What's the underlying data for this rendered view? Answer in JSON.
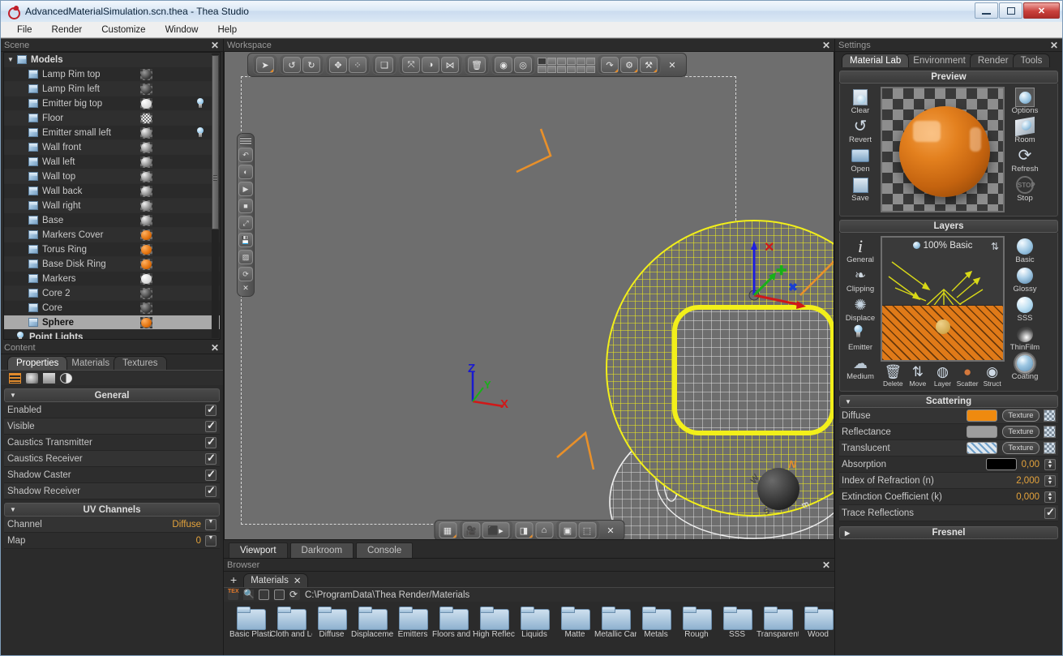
{
  "window": {
    "title": "AdvancedMaterialSimulation.scn.thea - Thea Studio",
    "app_icon": "thea-logo-icon",
    "minimize": "—",
    "maximize": "❐",
    "close": "✕"
  },
  "menu": [
    "File",
    "Render",
    "Customize",
    "Window",
    "Help"
  ],
  "scene_panel": {
    "title": "Scene",
    "close": "✕",
    "items": [
      {
        "label": "Models",
        "type": "group",
        "arrow": "▼",
        "thumb": null,
        "lamp": false
      },
      {
        "label": "Lamp Rim top",
        "type": "model",
        "thumb": "dark",
        "lamp": false
      },
      {
        "label": "Lamp Rim left",
        "type": "model",
        "thumb": "dark",
        "lamp": false
      },
      {
        "label": "Emitter big top",
        "type": "model",
        "thumb": "white",
        "lamp": true
      },
      {
        "label": "Floor",
        "type": "model",
        "thumb": "check",
        "lamp": false
      },
      {
        "label": "Emitter small left",
        "type": "model",
        "thumb": "grey",
        "lamp": true
      },
      {
        "label": "Wall front",
        "type": "model",
        "thumb": "grey",
        "lamp": false
      },
      {
        "label": "Wall left",
        "type": "model",
        "thumb": "grey",
        "lamp": false
      },
      {
        "label": "Wall top",
        "type": "model",
        "thumb": "grey",
        "lamp": false
      },
      {
        "label": "Wall back",
        "type": "model",
        "thumb": "grey",
        "lamp": false
      },
      {
        "label": "Wall right",
        "type": "model",
        "thumb": "grey",
        "lamp": false
      },
      {
        "label": "Base",
        "type": "model",
        "thumb": "grey",
        "lamp": false
      },
      {
        "label": "Markers Cover",
        "type": "model",
        "thumb": "orange",
        "lamp": false
      },
      {
        "label": "Torus Ring",
        "type": "model",
        "thumb": "orange",
        "lamp": false
      },
      {
        "label": "Base Disk Ring",
        "type": "model",
        "thumb": "orange",
        "lamp": false
      },
      {
        "label": "Markers",
        "type": "model",
        "thumb": "white",
        "lamp": false
      },
      {
        "label": "Core 2",
        "type": "model",
        "thumb": "dark",
        "lamp": false
      },
      {
        "label": "Core",
        "type": "model",
        "thumb": "dark",
        "lamp": false
      },
      {
        "label": "Sphere",
        "type": "model",
        "thumb": "orange",
        "lamp": false,
        "selected": true
      },
      {
        "label": "Point Lights",
        "type": "lights",
        "thumb": null,
        "lamp": false
      }
    ]
  },
  "content_panel": {
    "title": "Content",
    "close": "✕",
    "tabs": [
      {
        "label": "Properties",
        "active": true
      },
      {
        "label": "Materials",
        "active": false
      },
      {
        "label": "Textures",
        "active": false
      }
    ],
    "toolbar_icons": [
      "list-icon",
      "camera-icon",
      "clapperboard-icon",
      "sun-icon"
    ],
    "sections": [
      {
        "title": "General",
        "arrow": "▼",
        "rows": [
          {
            "label": "Enabled",
            "kind": "check",
            "checked": true
          },
          {
            "label": "Visible",
            "kind": "check",
            "checked": true
          },
          {
            "label": "Caustics Transmitter",
            "kind": "check",
            "checked": true
          },
          {
            "label": "Caustics Receiver",
            "kind": "check",
            "checked": true
          },
          {
            "label": "Shadow Caster",
            "kind": "check",
            "checked": true
          },
          {
            "label": "Shadow Receiver",
            "kind": "check",
            "checked": true
          }
        ]
      },
      {
        "title": "UV Channels",
        "arrow": "▼",
        "rows": [
          {
            "label": "Channel",
            "kind": "dropdown",
            "value": "Diffuse"
          },
          {
            "label": "Map",
            "kind": "dropdown",
            "value": "0"
          }
        ]
      }
    ]
  },
  "workspace": {
    "title": "Workspace",
    "close": "✕",
    "toolbar": {
      "groups": [
        {
          "buttons": [
            {
              "icon": "select-arrow-icon",
              "active": true
            }
          ]
        },
        {
          "buttons": [
            {
              "icon": "undo-icon"
            },
            {
              "icon": "redo-icon"
            }
          ]
        },
        {
          "buttons": [
            {
              "icon": "move-gizmo-icon"
            },
            {
              "icon": "points-icon"
            }
          ]
        },
        {
          "buttons": [
            {
              "icon": "copy-objects-icon"
            }
          ]
        },
        {
          "buttons": [
            {
              "icon": "axis-translate-icon"
            },
            {
              "icon": "rotate-icon"
            },
            {
              "icon": "node-icon"
            }
          ]
        },
        {
          "buttons": [
            {
              "icon": "trash-icon"
            }
          ]
        },
        {
          "buttons": [
            {
              "icon": "eye-icon"
            },
            {
              "icon": "eye-off-icon"
            }
          ]
        },
        {
          "buttons": [
            {
              "icon": "layer-grid-icon"
            }
          ]
        },
        {
          "buttons": [
            {
              "icon": "curve-arrow-icon"
            },
            {
              "icon": "gear-icon"
            },
            {
              "icon": "tools-icon"
            }
          ]
        },
        {
          "buttons": [
            {
              "icon": "close-icon"
            }
          ]
        }
      ]
    },
    "left_toolbar": [
      "grip-handle",
      "render-arc-icon",
      "render-play-circle-icon",
      "play-icon",
      "stop-icon",
      "fit-view-icon",
      "save-render-icon",
      "checker-icon",
      "refresh-icon",
      "close-icon"
    ],
    "bottom_toolbar": [
      "grid-display-icon",
      "camera-filmstrip-icon",
      "camera-lock-icon",
      "gradient-icon",
      "perspective-icon",
      "box-select-icon",
      "marquee-select-icon",
      "close-icon"
    ],
    "axis_gizmo": {
      "z": "Z",
      "y": "Y",
      "x": "X"
    },
    "compass": {
      "n": "N",
      "w": "W",
      "s": "S",
      "e": "E"
    },
    "tabs": [
      {
        "label": "Viewport",
        "active": true
      },
      {
        "label": "Darkroom",
        "active": false
      },
      {
        "label": "Console",
        "active": false
      }
    ]
  },
  "browser": {
    "title": "Browser",
    "close": "✕",
    "add_label": "+",
    "tab": {
      "label": "Materials",
      "close": "✕"
    },
    "path_icons": [
      "tex-icon",
      "search-icon",
      "up-folder-icon",
      "home-folder-icon",
      "refresh-icon"
    ],
    "path": "C:\\ProgramData\\Thea Render/Materials",
    "folders": [
      "Basic Plastic",
      "Cloth and Le",
      "Diffuse",
      "Displaceme",
      "Emitters",
      "Floors and T",
      "High Reflec",
      "Liquids",
      "Matte",
      "Metallic Car",
      "Metals",
      "Rough",
      "SSS",
      "Transparent",
      "Wood"
    ]
  },
  "settings": {
    "title": "Settings",
    "close": "✕",
    "tabs": [
      {
        "label": "Material Lab",
        "active": true
      },
      {
        "label": "Environment",
        "active": false
      },
      {
        "label": "Render",
        "active": false
      },
      {
        "label": "Tools",
        "active": false
      }
    ],
    "preview": {
      "title": "Preview",
      "left_buttons": [
        {
          "label": "Clear",
          "icon": "clear-page-icon"
        },
        {
          "label": "Revert",
          "icon": "revert-arrow-icon"
        },
        {
          "label": "Open",
          "icon": "open-folder-icon"
        },
        {
          "label": "Save",
          "icon": "save-disk-icon"
        }
      ],
      "right_buttons": [
        {
          "label": "Options",
          "icon": "options-sphere-icon"
        },
        {
          "label": "Room",
          "icon": "room-icon"
        },
        {
          "label": "Refresh",
          "icon": "refresh-icon"
        },
        {
          "label": "Stop",
          "icon": "stop-icon"
        }
      ]
    },
    "layers": {
      "title": "Layers",
      "left_buttons": [
        {
          "label": "General",
          "icon": "info-icon"
        },
        {
          "label": "Clipping",
          "icon": "clipping-icon"
        },
        {
          "label": "Displace",
          "icon": "displace-icon"
        },
        {
          "label": "Emitter",
          "icon": "bulb-icon"
        },
        {
          "label": "Medium",
          "icon": "medium-cloud-icon"
        }
      ],
      "right_buttons": [
        {
          "label": "Basic",
          "icon": "basic-sphere-icon"
        },
        {
          "label": "Glossy",
          "icon": "glossy-sphere-icon"
        },
        {
          "label": "SSS",
          "icon": "sss-sphere-icon"
        },
        {
          "label": "ThinFilm",
          "icon": "thinfilm-sphere-icon"
        },
        {
          "label": "Coating",
          "icon": "coating-sphere-icon"
        }
      ],
      "stack_label": "100% Basic",
      "swap_icon": "swap-arrows-icon",
      "tools": [
        {
          "label": "Delete",
          "icon": "trash-icon"
        },
        {
          "label": "Move",
          "icon": "move-updown-icon"
        },
        {
          "label": "Layer",
          "icon": "layer-settings-icon"
        },
        {
          "label": "Scatter",
          "icon": "scatter-sphere-icon"
        },
        {
          "label": "Struct",
          "icon": "structure-icon"
        }
      ]
    },
    "scattering": {
      "title": "Scattering",
      "arrow": "▼",
      "rows": [
        {
          "label": "Diffuse",
          "kind": "color-texture",
          "color": "#ef8a0f",
          "texture_label": "Texture"
        },
        {
          "label": "Reflectance",
          "kind": "color-texture",
          "color": "#9d9d9d",
          "texture_label": "Texture"
        },
        {
          "label": "Translucent",
          "kind": "diag-texture",
          "texture_label": "Texture"
        },
        {
          "label": "Absorption",
          "kind": "color-value",
          "color": "#000000",
          "value": "0,00"
        },
        {
          "label": "Index of Refraction (n)",
          "kind": "value",
          "value": "2,000"
        },
        {
          "label": "Extinction Coefficient (k)",
          "kind": "value",
          "value": "0,000"
        },
        {
          "label": "Trace Reflections",
          "kind": "check",
          "checked": true
        }
      ]
    },
    "fresnel": {
      "title": "Fresnel",
      "arrow": "▶"
    }
  },
  "colors": {
    "accent_orange": "#e08a2c",
    "selection_yellow": "#f2ef1a",
    "panel_bg": "#2b2b2b",
    "viewport_bg": "#6e6e6e"
  }
}
